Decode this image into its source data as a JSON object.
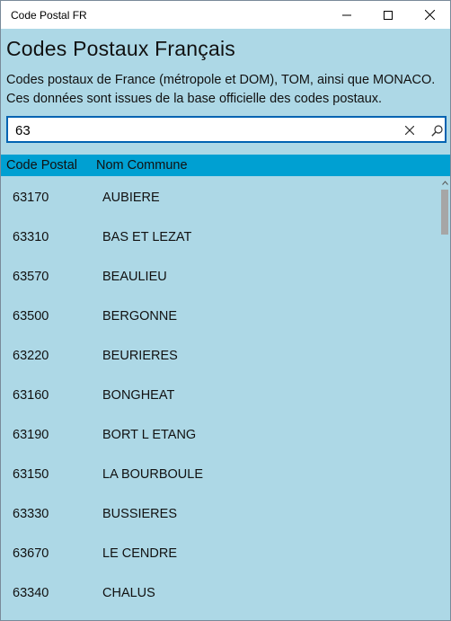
{
  "window": {
    "title": "Code Postal FR",
    "minimize_icon": "minimize-icon",
    "maximize_icon": "maximize-icon",
    "close_icon": "close-icon"
  },
  "header": {
    "title": "Codes Postaux Français",
    "description_line1": "Codes postaux de France (métropole et DOM), TOM, ainsi que MONACO.",
    "description_line2": "Ces données sont issues de la base officielle des codes postaux."
  },
  "search": {
    "value": "63",
    "clear_icon": "clear-icon",
    "search_icon": "search-icon",
    "border_color": "#0063b1"
  },
  "columns": {
    "code": "Code Postal",
    "nom": "Nom Commune"
  },
  "colors": {
    "background": "#add8e6",
    "header_bar": "#00a0d2"
  },
  "rows": [
    {
      "code": "63170",
      "nom": "AUBIERE"
    },
    {
      "code": "63310",
      "nom": "BAS ET LEZAT"
    },
    {
      "code": "63570",
      "nom": "BEAULIEU"
    },
    {
      "code": "63500",
      "nom": "BERGONNE"
    },
    {
      "code": "63220",
      "nom": "BEURIERES"
    },
    {
      "code": "63160",
      "nom": "BONGHEAT"
    },
    {
      "code": "63190",
      "nom": "BORT L ETANG"
    },
    {
      "code": "63150",
      "nom": "LA BOURBOULE"
    },
    {
      "code": "63330",
      "nom": "BUSSIERES"
    },
    {
      "code": "63670",
      "nom": "LE CENDRE"
    },
    {
      "code": "63340",
      "nom": "CHALUS"
    }
  ]
}
